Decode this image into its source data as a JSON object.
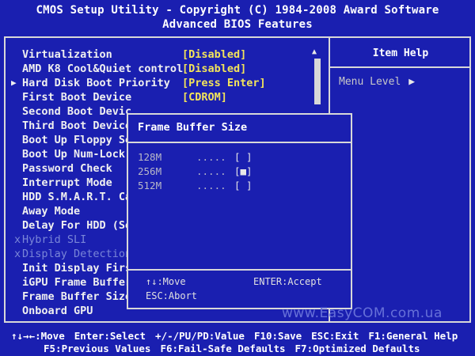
{
  "header": {
    "title": "CMOS Setup Utility - Copyright (C) 1984-2008 Award Software",
    "subtitle": "Advanced BIOS Features"
  },
  "help_panel": {
    "title": "Item Help",
    "menu_level_label": "Menu Level",
    "menu_level_arrow": "▶"
  },
  "settings": [
    {
      "label": "Virtualization",
      "value": "[Disabled]",
      "marker": "",
      "disabled": false
    },
    {
      "label": "AMD K8 Cool&Quiet control",
      "value": "[Disabled]",
      "marker": "",
      "disabled": false
    },
    {
      "label": "Hard Disk Boot Priority",
      "value": "[Press Enter]",
      "marker": "▶",
      "disabled": false
    },
    {
      "label": "First Boot Device",
      "value": "[CDROM]",
      "marker": "",
      "disabled": false
    },
    {
      "label": "Second Boot Devic",
      "value": "",
      "marker": "",
      "disabled": false
    },
    {
      "label": "Third Boot Device",
      "value": "",
      "marker": "",
      "disabled": false
    },
    {
      "label": "Boot Up Floppy Se",
      "value": "",
      "marker": "",
      "disabled": false
    },
    {
      "label": "Boot Up Num-Lock",
      "value": "",
      "marker": "",
      "disabled": false
    },
    {
      "label": "Password Check",
      "value": "",
      "marker": "",
      "disabled": false
    },
    {
      "label": "Interrupt Mode",
      "value": "",
      "marker": "",
      "disabled": false
    },
    {
      "label": "HDD S.M.A.R.T. Ca",
      "value": "",
      "marker": "",
      "disabled": false
    },
    {
      "label": "Away Mode",
      "value": "",
      "marker": "",
      "disabled": false
    },
    {
      "label": "Delay For HDD (Se",
      "value": "",
      "marker": "",
      "disabled": false
    },
    {
      "label": "Hybrid SLI",
      "value": "",
      "marker": "x",
      "disabled": true
    },
    {
      "label": "Display Detection",
      "value": "",
      "marker": "x",
      "disabled": true
    },
    {
      "label": "Init Display Firs",
      "value": "",
      "marker": "",
      "disabled": false
    },
    {
      "label": "iGPU Frame Buffer",
      "value": "",
      "marker": "",
      "disabled": false
    },
    {
      "label": "Frame Buffer Size",
      "value": "",
      "marker": "",
      "disabled": false
    },
    {
      "label": "Onboard GPU",
      "value": "",
      "marker": "",
      "disabled": false
    }
  ],
  "scrollbar": {
    "up_arrow": "▲"
  },
  "popup": {
    "title": "Frame Buffer Size",
    "options": [
      {
        "label": "128M",
        "dots": ".....",
        "box": "[ ]"
      },
      {
        "label": "256M",
        "dots": ".....",
        "box": "[■]"
      },
      {
        "label": "512M",
        "dots": ".....",
        "box": "[ ]"
      }
    ],
    "hint_move": "↑↓:Move",
    "hint_accept": "ENTER:Accept",
    "hint_abort": "ESC:Abort"
  },
  "watermark": "www.EasyCOM.com.ua",
  "footer": {
    "line1": [
      "↑↓→←:Move",
      "Enter:Select",
      "+/-/PU/PD:Value",
      "F10:Save",
      "ESC:Exit",
      "F1:General Help"
    ],
    "line2": [
      "F5:Previous Values",
      "F6:Fail-Safe Defaults",
      "F7:Optimized Defaults"
    ]
  }
}
